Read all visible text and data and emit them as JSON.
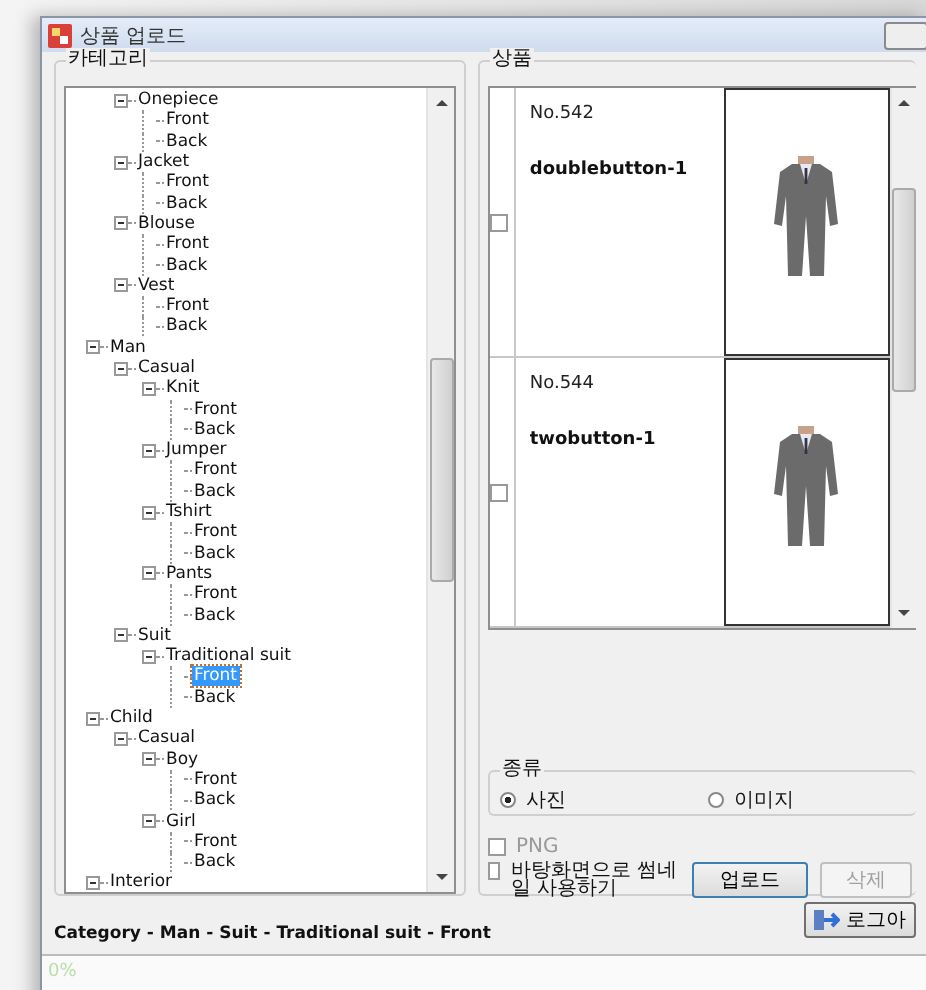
{
  "window": {
    "title": "상품 업로드"
  },
  "category": {
    "title": "카테고리",
    "tree": [
      {
        "children": [
          {
            "label": "Onepiece",
            "expanded": true,
            "children": [
              {
                "label": "Front",
                "selected": false
              },
              {
                "label": "Back",
                "selected": false
              }
            ]
          },
          {
            "label": "Jacket",
            "expanded": true,
            "children": [
              {
                "label": "Front",
                "selected": false
              },
              {
                "label": "Back",
                "selected": false
              }
            ]
          },
          {
            "label": "Blouse",
            "expanded": true,
            "children": [
              {
                "label": "Front",
                "selected": false
              },
              {
                "label": "Back",
                "selected": false
              }
            ]
          },
          {
            "label": "Vest",
            "expanded": true,
            "children": [
              {
                "label": "Front",
                "selected": false
              },
              {
                "label": "Back",
                "selected": false
              }
            ]
          }
        ]
      },
      {
        "label": "Man",
        "expanded": true,
        "children": [
          {
            "label": "Casual",
            "expanded": true,
            "children": [
              {
                "label": "Knit",
                "expanded": true,
                "children": [
                  {
                    "label": "Front",
                    "selected": false
                  },
                  {
                    "label": "Back",
                    "selected": false
                  }
                ]
              },
              {
                "label": "Jumper",
                "expanded": true,
                "children": [
                  {
                    "label": "Front",
                    "selected": false
                  },
                  {
                    "label": "Back",
                    "selected": false
                  }
                ]
              },
              {
                "label": "Tshirt",
                "expanded": true,
                "children": [
                  {
                    "label": "Front",
                    "selected": false
                  },
                  {
                    "label": "Back",
                    "selected": false
                  }
                ]
              },
              {
                "label": "Pants",
                "expanded": true,
                "children": [
                  {
                    "label": "Front",
                    "selected": false
                  },
                  {
                    "label": "Back",
                    "selected": false
                  }
                ]
              }
            ]
          },
          {
            "label": "Suit",
            "expanded": true,
            "children": [
              {
                "label": "Traditional suit",
                "expanded": true,
                "children": [
                  {
                    "label": "Front",
                    "selected": true
                  },
                  {
                    "label": "Back",
                    "selected": false
                  }
                ]
              }
            ]
          }
        ]
      },
      {
        "label": "Child",
        "expanded": true,
        "children": [
          {
            "label": "Casual",
            "expanded": true,
            "children": [
              {
                "label": "Boy",
                "expanded": true,
                "children": [
                  {
                    "label": "Front",
                    "selected": false
                  },
                  {
                    "label": "Back",
                    "selected": false
                  }
                ]
              },
              {
                "label": "Girl",
                "expanded": true,
                "children": [
                  {
                    "label": "Front",
                    "selected": false
                  },
                  {
                    "label": "Back",
                    "selected": false
                  }
                ]
              }
            ]
          }
        ]
      },
      {
        "label": "Interior",
        "expanded": true
      }
    ],
    "path": "Category - Man - Suit - Traditional suit - Front"
  },
  "products": {
    "title": "상품",
    "items": [
      {
        "number": "No.542",
        "name": "doublebutton-1",
        "checked": false
      },
      {
        "number": "No.544",
        "name": "twobutton-1",
        "checked": false
      }
    ]
  },
  "type_group": {
    "title": "종류",
    "options": [
      {
        "label": "사진",
        "selected": true
      },
      {
        "label": "이미지",
        "selected": false
      }
    ]
  },
  "png": {
    "label": "PNG",
    "checked": false,
    "disabled": true
  },
  "wallpaper": {
    "label": "바탕화면으로 썸네일 사용하기",
    "checked": false
  },
  "buttons": {
    "upload": "업로드",
    "delete": {
      "label": "삭제",
      "disabled": true
    },
    "logout": "로그아"
  },
  "progress": {
    "label": "0%",
    "level": 0
  }
}
